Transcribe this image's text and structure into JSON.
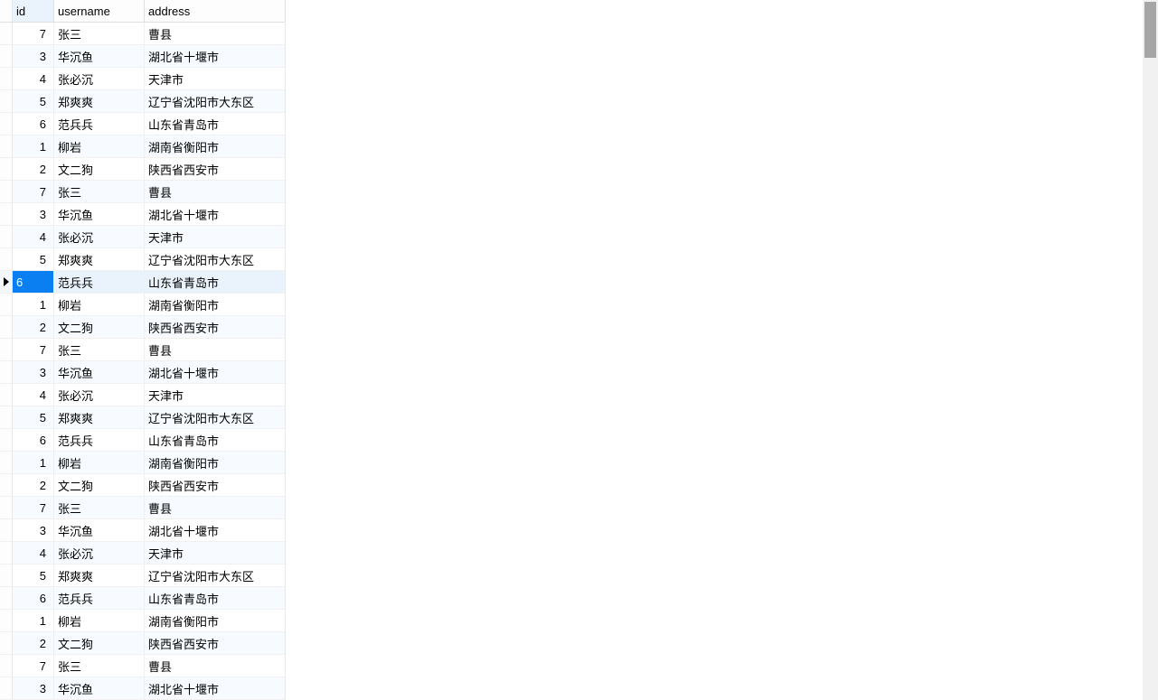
{
  "columns": {
    "id": "id",
    "username": "username",
    "address": "address"
  },
  "selectedRowIndex": 11,
  "rows": [
    {
      "id": "7",
      "username": "张三",
      "address": "曹县"
    },
    {
      "id": "3",
      "username": "华沉鱼",
      "address": "湖北省十堰市"
    },
    {
      "id": "4",
      "username": "张必沉",
      "address": "天津市"
    },
    {
      "id": "5",
      "username": "郑爽爽",
      "address": "辽宁省沈阳市大东区"
    },
    {
      "id": "6",
      "username": "范兵兵",
      "address": "山东省青岛市"
    },
    {
      "id": "1",
      "username": "柳岩",
      "address": "湖南省衡阳市"
    },
    {
      "id": "2",
      "username": "文二狗",
      "address": "陕西省西安市"
    },
    {
      "id": "7",
      "username": "张三",
      "address": "曹县"
    },
    {
      "id": "3",
      "username": "华沉鱼",
      "address": "湖北省十堰市"
    },
    {
      "id": "4",
      "username": "张必沉",
      "address": "天津市"
    },
    {
      "id": "5",
      "username": "郑爽爽",
      "address": "辽宁省沈阳市大东区"
    },
    {
      "id": "6",
      "username": "范兵兵",
      "address": "山东省青岛市"
    },
    {
      "id": "1",
      "username": "柳岩",
      "address": "湖南省衡阳市"
    },
    {
      "id": "2",
      "username": "文二狗",
      "address": "陕西省西安市"
    },
    {
      "id": "7",
      "username": "张三",
      "address": "曹县"
    },
    {
      "id": "3",
      "username": "华沉鱼",
      "address": "湖北省十堰市"
    },
    {
      "id": "4",
      "username": "张必沉",
      "address": "天津市"
    },
    {
      "id": "5",
      "username": "郑爽爽",
      "address": "辽宁省沈阳市大东区"
    },
    {
      "id": "6",
      "username": "范兵兵",
      "address": "山东省青岛市"
    },
    {
      "id": "1",
      "username": "柳岩",
      "address": "湖南省衡阳市"
    },
    {
      "id": "2",
      "username": "文二狗",
      "address": "陕西省西安市"
    },
    {
      "id": "7",
      "username": "张三",
      "address": "曹县"
    },
    {
      "id": "3",
      "username": "华沉鱼",
      "address": "湖北省十堰市"
    },
    {
      "id": "4",
      "username": "张必沉",
      "address": "天津市"
    },
    {
      "id": "5",
      "username": "郑爽爽",
      "address": "辽宁省沈阳市大东区"
    },
    {
      "id": "6",
      "username": "范兵兵",
      "address": "山东省青岛市"
    },
    {
      "id": "1",
      "username": "柳岩",
      "address": "湖南省衡阳市"
    },
    {
      "id": "2",
      "username": "文二狗",
      "address": "陕西省西安市"
    },
    {
      "id": "7",
      "username": "张三",
      "address": "曹县"
    },
    {
      "id": "3",
      "username": "华沉鱼",
      "address": "湖北省十堰市"
    }
  ]
}
